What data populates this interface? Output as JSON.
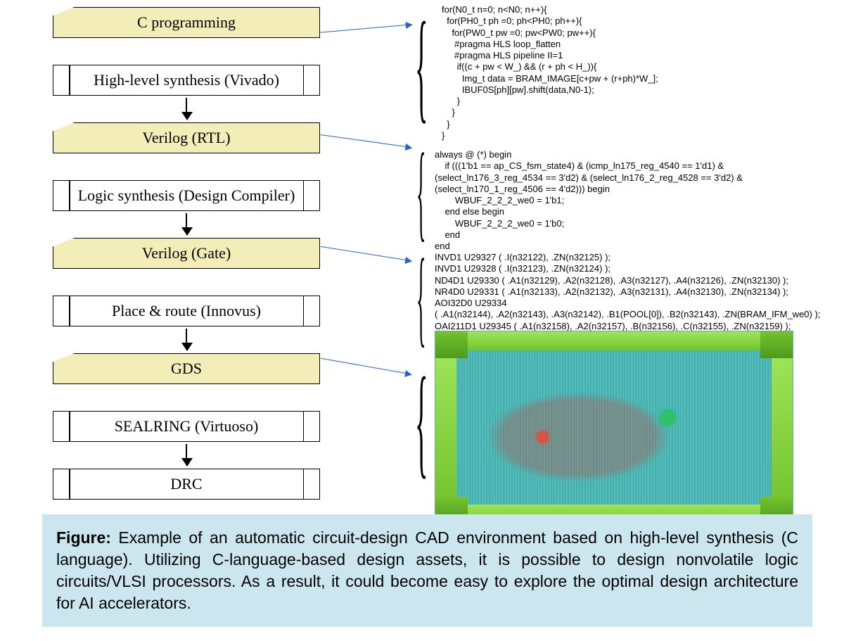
{
  "flow": {
    "steps": [
      {
        "label": "C programming",
        "kind": "yellow"
      },
      {
        "label": "High-level synthesis (Vivado)",
        "kind": "white"
      },
      {
        "label": "Verilog (RTL)",
        "kind": "yellow"
      },
      {
        "label": "Logic synthesis (Design Compiler)",
        "kind": "white"
      },
      {
        "label": "Verilog (Gate)",
        "kind": "yellow"
      },
      {
        "label": "Place & route (Innovus)",
        "kind": "white"
      },
      {
        "label": "GDS",
        "kind": "yellow"
      },
      {
        "label": "SEALRING (Virtuoso)",
        "kind": "white"
      },
      {
        "label": "DRC",
        "kind": "white"
      }
    ]
  },
  "annotations": {
    "c_code": "for(N0_t n=0; n<N0; n++){\n  for(PH0_t ph =0; ph<PH0; ph++){\n    for(PW0_t pw =0; pw<PW0; pw++){\n     #pragma HLS loop_flatten\n     #pragma HLS pipeline II=1\n      if((c + pw < W_) && (r + ph < H_)){\n        Img_t data = BRAM_IMAGE[c+pw + (r+ph)*W_];\n        IBUF0S[ph][pw].shift(data,N0-1);\n      }\n    }\n  }\n}",
    "rtl_code": "always @ (*) begin\n    if (((1'b1 == ap_CS_fsm_state4) & (icmp_ln175_reg_4540 == 1'd1) &\n(select_ln176_3_reg_4534 == 3'd2) & (select_ln176_2_reg_4528 == 3'd2) &\n(select_ln170_1_reg_4506 == 4'd2))) begin\n        WBUF_2_2_2_we0 = 1'b1;\n    end else begin\n        WBUF_2_2_2_we0 = 1'b0;\n    end\nend",
    "gate_code": "INVD1 U29327 ( .I(n32122), .ZN(n32125) );\nINVD1 U29328 ( .I(n32123), .ZN(n32124) );\nND4D1 U29330 ( .A1(n32129), .A2(n32128), .A3(n32127), .A4(n32126), .ZN(n32130) );\nNR4D0 U29331 ( .A1(n32133), .A2(n32132), .A3(n32131), .A4(n32130), .ZN(n32134) );\nAOI32D0 U29334\n( .A1(n32144), .A2(n32143), .A3(n32142), .B1(POOL[0]), .B2(n32143), .ZN(BRAM_IFM_we0) );\nOAI211D1 U29345 ( .A1(n32158), .A2(n32157), .B(n32156), .C(n32155), .ZN(n32159) );"
  },
  "caption": {
    "prefix": "Figure:",
    "body": " Example of an automatic circuit-design CAD environment based on high-level synthesis (C language). Utilizing C-language-based design assets, it is possible to design nonvolatile logic circuits/VLSI processors. As a result, it could become easy to explore the optimal design architecture for AI accelerators."
  },
  "colors": {
    "step_yellow": "#f3eeb8",
    "caption_bg": "#cbe6ef",
    "arrow_blue": "#2a60c9"
  }
}
